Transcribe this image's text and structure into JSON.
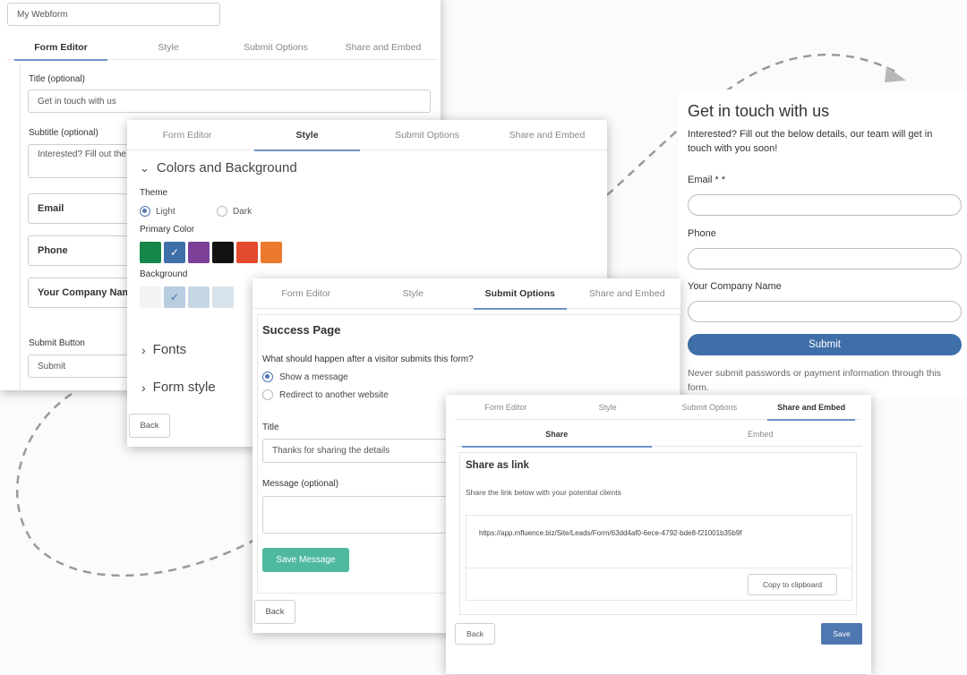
{
  "colors": {
    "accent": "#4f77b0",
    "primary_btn": "#3e6fa9",
    "save_msg": "#4fb99f",
    "swatches": [
      "#16874a",
      "#3e6fa9",
      "#7b3f98",
      "#121212",
      "#e34a2e",
      "#eb7a2e"
    ],
    "bg_swatches": [
      "#f3f3f3",
      "#b8cde0",
      "#c7d6e3",
      "#d8e2ea"
    ]
  },
  "panel1": {
    "form_name": "My Webform",
    "tabs": [
      "Form Editor",
      "Style",
      "Submit Options",
      "Share and Embed"
    ],
    "title_label": "Title (optional)",
    "title_value": "Get in touch with us",
    "subtitle_label": "Subtitle (optional)",
    "subtitle_value": "Interested? Fill out the",
    "field_email": "Email",
    "field_phone": "Phone",
    "field_company": "Your Company Nam",
    "submit_label": "Submit Button",
    "submit_value": "Submit"
  },
  "panel2": {
    "tabs": [
      "Form Editor",
      "Style",
      "Submit Options",
      "Share and Embed"
    ],
    "section_colors": "Colors and Background",
    "theme_label": "Theme",
    "theme_light": "Light",
    "theme_dark": "Dark",
    "primary_label": "Primary Color",
    "background_label": "Background",
    "section_fonts": "Fonts",
    "section_form_style": "Form style",
    "back": "Back"
  },
  "panel3": {
    "tabs": [
      "Form Editor",
      "Style",
      "Submit Options",
      "Share and Embed"
    ],
    "heading": "Success Page",
    "question": "What should happen after a visitor submits this form?",
    "opt_message": "Show a message",
    "opt_redirect": "Redirect to another website",
    "title_label": "Title",
    "title_value": "Thanks for sharing the details",
    "message_label": "Message (optional)",
    "save_message": "Save Message",
    "back": "Back"
  },
  "panel4": {
    "tabs": [
      "Form Editor",
      "Style",
      "Submit Options",
      "Share and Embed"
    ],
    "subtabs": [
      "Share",
      "Embed"
    ],
    "heading": "Share as link",
    "desc": "Share the link below with your potential clients",
    "link": "https://app.mfluence.biz/Site/Leads/Form/63dd4af0-6ece-4792-bde8-f21001b35b9f",
    "copy": "Copy to clipboard",
    "back": "Back",
    "save": "Save"
  },
  "preview": {
    "title": "Get in touch with us",
    "subtitle": "Interested? Fill out the below details, our team will get in touch with you soon!",
    "email_label": "Email * *",
    "phone_label": "Phone",
    "company_label": "Your Company Name",
    "submit": "Submit",
    "notice": "Never submit passwords or payment information through this form."
  }
}
